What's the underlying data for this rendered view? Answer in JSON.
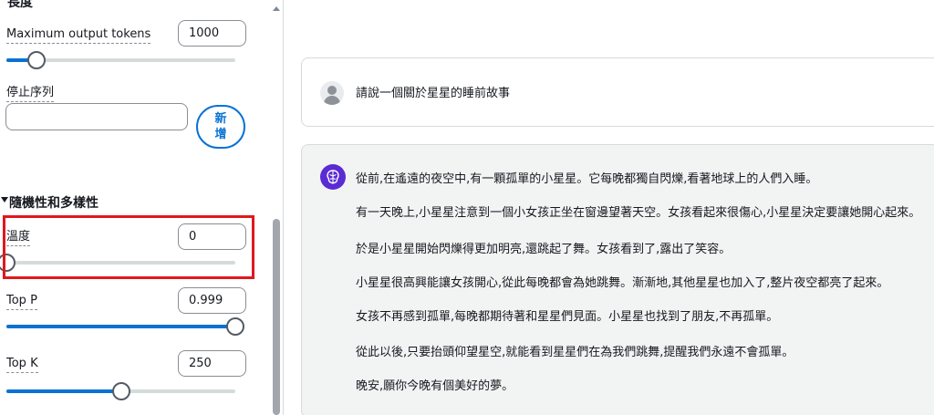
{
  "settings": {
    "top_section_title": "長度",
    "max_tokens": {
      "label": "Maximum output tokens",
      "value": "1000",
      "slider_fraction": 0.13
    },
    "stop_sequences": {
      "label": "停止序列",
      "input_value": "",
      "add_button_label": "新增"
    },
    "randomness": {
      "title": "隨機性和多樣性",
      "temperature": {
        "label": "溫度",
        "value": "0",
        "slider_fraction": 0.0
      },
      "top_p": {
        "label": "Top P",
        "value": "0.999",
        "slider_fraction": 1.0
      },
      "top_k": {
        "label": "Top K",
        "value": "250",
        "slider_fraction": 0.5
      }
    }
  },
  "chat": {
    "user_message": "請說一個關於星星的睡前故事",
    "assistant_lines": [
      "從前,在遙遠的夜空中,有一顆孤單的小星星。它每晚都獨自閃爍,看著地球上的人們入睡。",
      "有一天晚上,小星星注意到一個小女孩正坐在窗邊望著天空。女孩看起來很傷心,小星星決定要讓她開心起來。",
      "於是小星星開始閃爍得更加明亮,還跳起了舞。女孩看到了,露出了笑容。",
      "小星星很高興能讓女孩開心,從此每晚都會為她跳舞。漸漸地,其他星星也加入了,整片夜空都亮了起來。",
      "女孩不再感到孤單,每晚都期待著和星星們見面。小星星也找到了朋友,不再孤單。",
      "從此以後,只要抬頭仰望星空,就能看到星星們在為我們跳舞,提醒我們永遠不會孤單。",
      "晚安,願你今晚有個美好的夢。"
    ]
  },
  "colors": {
    "accent": "#0972d3",
    "highlight_box": "#e0181e",
    "assistant_avatar": "#5b2bd3",
    "assistant_bubble": "#f2f3f3"
  },
  "icons": {
    "user_avatar": "user-avatar-icon",
    "assistant_avatar": "brain-icon",
    "section_toggle": "caret-down-icon",
    "scroll_up": "scroll-up-arrow-icon"
  }
}
